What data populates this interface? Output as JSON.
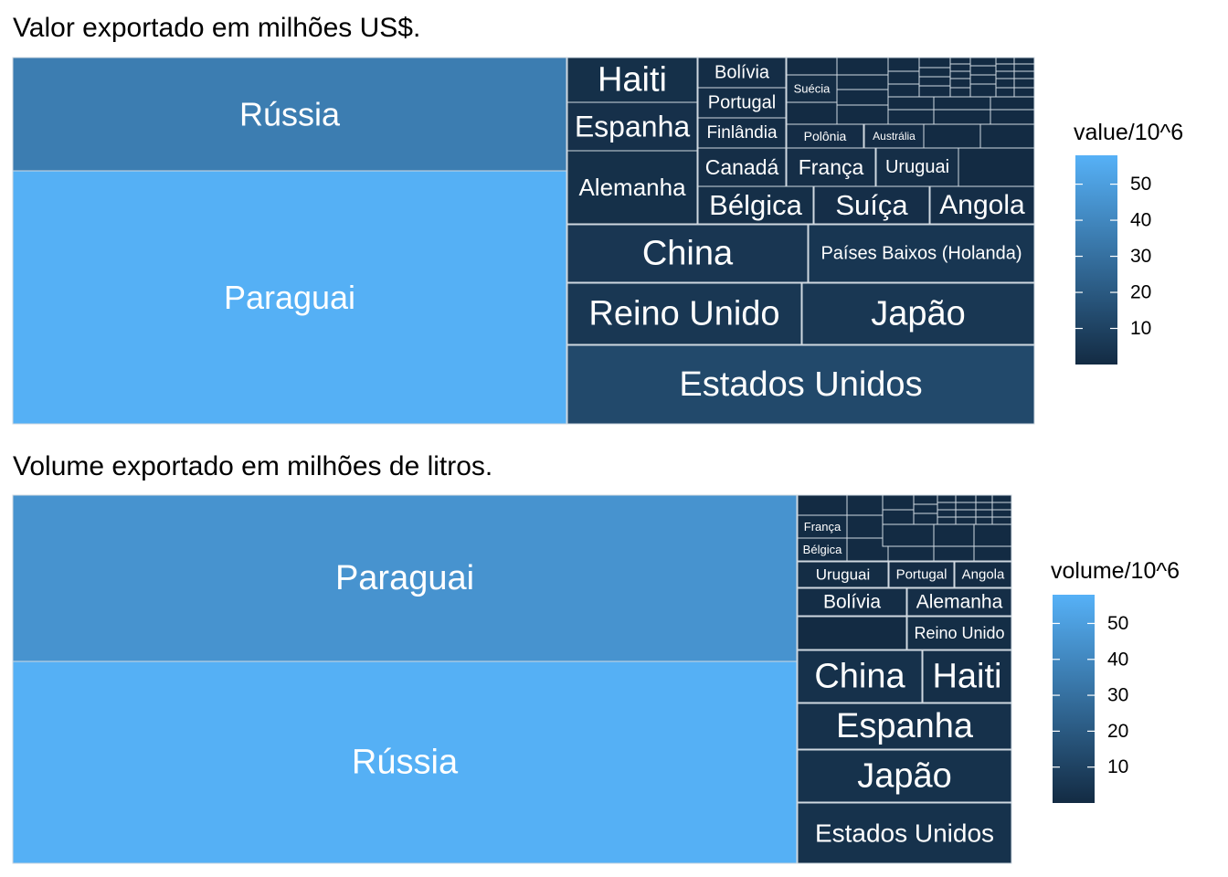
{
  "colors": {
    "low": "#132B43",
    "high": "#56B1F7",
    "border": "#cfd8e0",
    "text": "#ffffff"
  },
  "chart_data": [
    {
      "type": "treemap",
      "title": "Valor exportado em milhões US$.",
      "legend_title": "value/10^6",
      "legend_placement": "right",
      "legend_ticks": [
        10,
        20,
        30,
        40,
        50
      ],
      "value_range": [
        0,
        58
      ],
      "tiles": [
        {
          "label": "Paraguai",
          "value": 57.5
        },
        {
          "label": "Rússia",
          "value": 35.5
        },
        {
          "label": "Estados Unidos",
          "value": 13.0
        },
        {
          "label": "Reino Unido",
          "value": 5.2
        },
        {
          "label": "Japão",
          "value": 5.2
        },
        {
          "label": "China",
          "value": 4.8
        },
        {
          "label": "Países Baixos (Holanda)",
          "value": 4.7
        },
        {
          "label": "Haiti",
          "value": 2.0
        },
        {
          "label": "Espanha",
          "value": 2.2
        },
        {
          "label": "Alemanha",
          "value": 2.0
        },
        {
          "label": "Bélgica",
          "value": 1.6
        },
        {
          "label": "Suíça",
          "value": 1.5
        },
        {
          "label": "Angola",
          "value": 1.4
        },
        {
          "label": "Canadá",
          "value": 1.4
        },
        {
          "label": "França",
          "value": 1.4
        },
        {
          "label": "Uruguai",
          "value": 1.3
        },
        {
          "label": "Bolívia",
          "value": 1.0
        },
        {
          "label": "Portugal",
          "value": 1.0
        },
        {
          "label": "Finlândia",
          "value": 1.0
        },
        {
          "label": "Suécia",
          "value": 0.7
        },
        {
          "label": "Polônia",
          "value": 0.5
        },
        {
          "label": "Austrália",
          "value": 0.5
        }
      ]
    },
    {
      "type": "treemap",
      "title": "Volume exportado em milhões de litros.",
      "legend_title": "volume/10^6",
      "legend_placement": "right",
      "legend_ticks": [
        10,
        20,
        30,
        40,
        50
      ],
      "value_range": [
        0,
        58
      ],
      "tiles": [
        {
          "label": "Rússia",
          "value": 57.5
        },
        {
          "label": "Paraguai",
          "value": 45.0
        },
        {
          "label": "Estados Unidos",
          "value": 3.0
        },
        {
          "label": "Japão",
          "value": 3.0
        },
        {
          "label": "Espanha",
          "value": 2.6
        },
        {
          "label": "China",
          "value": 2.5
        },
        {
          "label": "Haiti",
          "value": 1.6
        },
        {
          "label": "Alemanha",
          "value": 1.3
        },
        {
          "label": "Reino Unido",
          "value": 1.1
        },
        {
          "label": "Bolívia",
          "value": 1.0
        },
        {
          "label": "Uruguai",
          "value": 0.7
        },
        {
          "label": "Portugal",
          "value": 0.55
        },
        {
          "label": "Angola",
          "value": 0.45
        },
        {
          "label": "França",
          "value": 0.4
        },
        {
          "label": "Bélgica",
          "value": 0.3
        }
      ]
    }
  ]
}
